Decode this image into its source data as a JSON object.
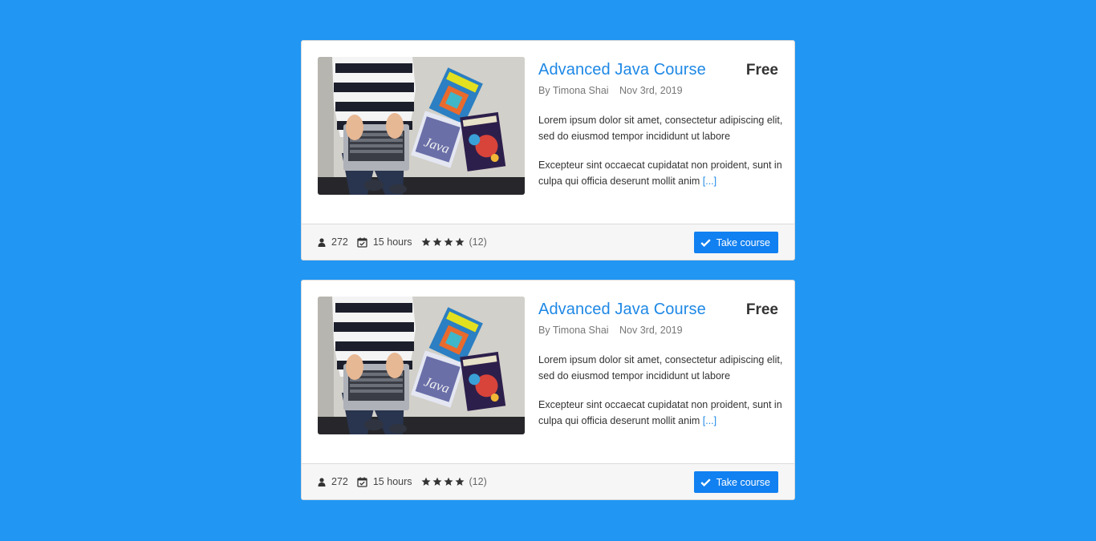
{
  "courses": [
    {
      "title": "Advanced Java Course",
      "price": "Free",
      "author": "By Timona Shai",
      "date": "Nov 3rd, 2019",
      "description_1": "Lorem ipsum dolor sit amet, consectetur adipiscing elit, sed do eiusmod tempor incididunt ut labore",
      "description_2": "Excepteur sint occaecat cupidatat non proident, sunt in culpa qui officia deserunt mollit anim",
      "more_link": "[...]",
      "students": "272",
      "duration": "15 hours",
      "rating": 4,
      "reviews": "(12)",
      "button_label": "Take course",
      "image_icon": "course-photo-laptop-books"
    },
    {
      "title": "Advanced Java Course",
      "price": "Free",
      "author": "By Timona Shai",
      "date": "Nov 3rd, 2019",
      "description_1": "Lorem ipsum dolor sit amet, consectetur adipiscing elit, sed do eiusmod tempor incididunt ut labore",
      "description_2": "Excepteur sint occaecat cupidatat non proident, sunt in culpa qui officia deserunt mollit anim",
      "more_link": "[...]",
      "students": "272",
      "duration": "15 hours",
      "rating": 4,
      "reviews": "(12)",
      "button_label": "Take course",
      "image_icon": "course-photo-laptop-books"
    }
  ],
  "colors": {
    "page_background": "#2196f3",
    "accent": "#1e88e5",
    "button": "#1180f0",
    "footer_background": "#f6f6f6"
  },
  "icons": {
    "students": "user-icon",
    "duration": "calendar-check-icon",
    "rating": "star-icon",
    "button": "check-icon"
  }
}
